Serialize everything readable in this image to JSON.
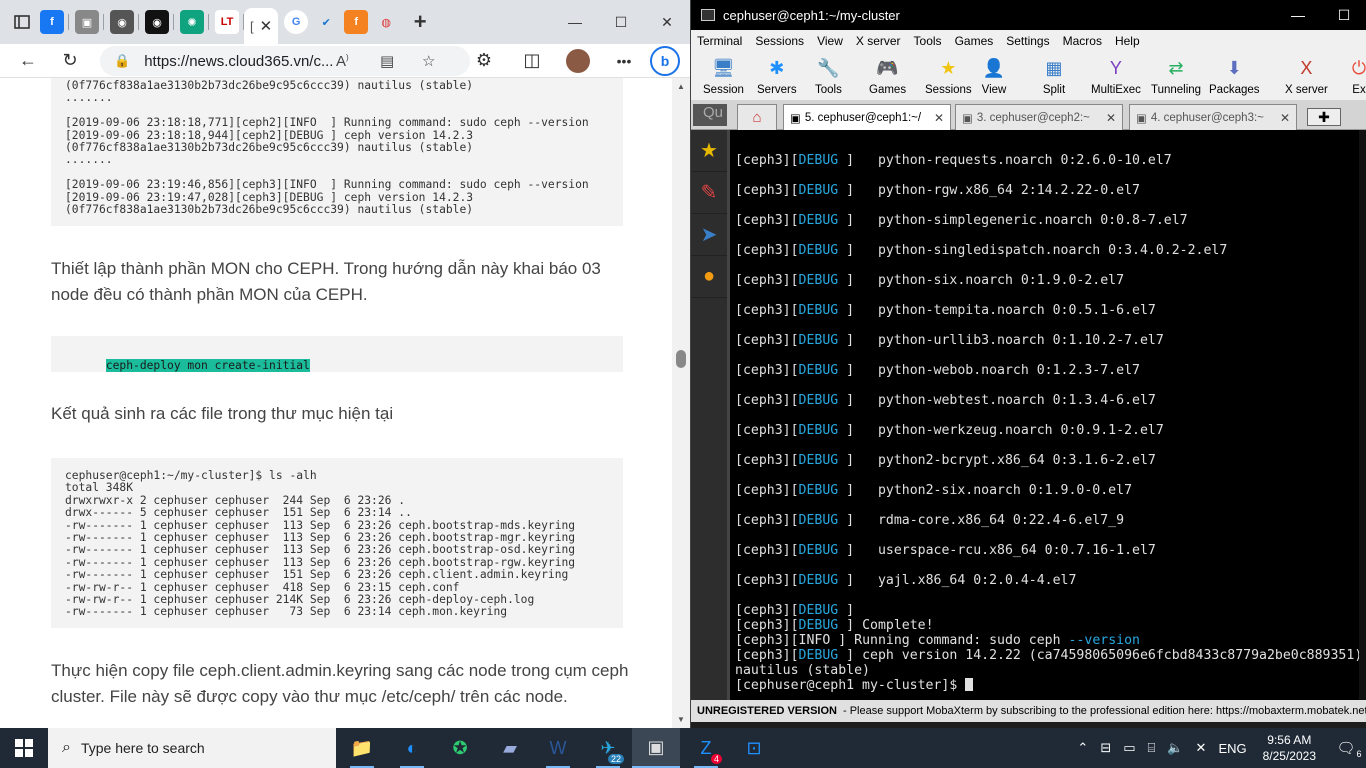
{
  "browser": {
    "tabs": [
      {
        "name": "tab-facebook",
        "glyph": "f",
        "bg": "#1877f2",
        "fg": "#fff"
      },
      {
        "name": "tab-box",
        "glyph": "▣",
        "bg": "#888",
        "fg": "#fff"
      },
      {
        "name": "tab-github-1",
        "glyph": "◉",
        "bg": "#555",
        "fg": "#fff"
      },
      {
        "name": "tab-github-2",
        "glyph": "◉",
        "bg": "#111",
        "fg": "#fff"
      },
      {
        "name": "tab-chatgpt",
        "glyph": "✺",
        "bg": "#10a37f",
        "fg": "#fff"
      },
      {
        "name": "tab-lt",
        "glyph": "LT",
        "bg": "#fff",
        "fg": "#c00"
      },
      {
        "name": "tab-google",
        "glyph": "G",
        "bg": "#fff",
        "fg": "#4285f4"
      },
      {
        "name": "tab-vk",
        "glyph": "✔",
        "bg": "#fff",
        "fg": "#1976d2"
      },
      {
        "name": "tab-f-orange",
        "glyph": "f",
        "bg": "#f58220",
        "fg": "#fff"
      },
      {
        "name": "tab-pinterest",
        "glyph": "◍",
        "bg": "#fff",
        "fg": "#d33"
      }
    ],
    "active_tab_glyph": "[",
    "url": "https://news.cloud365.vn/c...",
    "code_top": "(0f776cf838a1ae3130b2b73dc26be9c95c6ccc39) nautilus (stable)\n.......\n\n[2019-09-06 23:18:18,771][ceph2][INFO  ] Running command: sudo ceph --version\n[2019-09-06 23:18:18,944][ceph2][DEBUG ] ceph version 14.2.3\n(0f776cf838a1ae3130b2b73dc26be9c95c6ccc39) nautilus (stable)\n.......\n\n[2019-09-06 23:19:46,856][ceph3][INFO  ] Running command: sudo ceph --version\n[2019-09-06 23:19:47,028][ceph3][DEBUG ] ceph version 14.2.3\n(0f776cf838a1ae3130b2b73dc26be9c95c6ccc39) nautilus (stable)",
    "para1": "Thiết lập thành phần MON cho CEPH. Trong hướng dẫn này khai báo 03 node đều có thành phần MON của CEPH.",
    "cmd": "ceph-deploy mon create-initial",
    "para2": "Kết quả sinh ra các file trong thư mục hiện tại",
    "code_ls": "cephuser@ceph1:~/my-cluster]$ ls -alh\ntotal 348K\ndrwxrwxr-x 2 cephuser cephuser  244 Sep  6 23:26 .\ndrwx------ 5 cephuser cephuser  151 Sep  6 23:14 ..\n-rw------- 1 cephuser cephuser  113 Sep  6 23:26 ceph.bootstrap-mds.keyring\n-rw------- 1 cephuser cephuser  113 Sep  6 23:26 ceph.bootstrap-mgr.keyring\n-rw------- 1 cephuser cephuser  113 Sep  6 23:26 ceph.bootstrap-osd.keyring\n-rw------- 1 cephuser cephuser  113 Sep  6 23:26 ceph.bootstrap-rgw.keyring\n-rw------- 1 cephuser cephuser  151 Sep  6 23:26 ceph.client.admin.keyring\n-rw-rw-r-- 1 cephuser cephuser  418 Sep  6 23:15 ceph.conf\n-rw-rw-r-- 1 cephuser cephuser 214K Sep  6 23:26 ceph-deploy-ceph.log\n-rw------- 1 cephuser cephuser   73 Sep  6 23:14 ceph.mon.keyring",
    "para3": "Thực hiện copy file ceph.client.admin.keyring sang các node trong cụm ceph cluster. File này sẽ được copy vào thư mục /etc/ceph/ trên các node."
  },
  "moba": {
    "title": "cephuser@ceph1:~/my-cluster",
    "menu": [
      "Terminal",
      "Sessions",
      "View",
      "X server",
      "Tools",
      "Games",
      "Settings",
      "Macros",
      "Help"
    ],
    "toolbar": [
      {
        "label": "Session",
        "icon": "🖥"
      },
      {
        "label": "Servers",
        "icon": "✱"
      },
      {
        "label": "Tools",
        "icon": "🔧"
      },
      {
        "label": "Games",
        "icon": "🎮"
      },
      {
        "label": "Sessions",
        "icon": "★"
      },
      {
        "label": "View",
        "icon": "👤"
      },
      {
        "label": "Split",
        "icon": "▦"
      },
      {
        "label": "MultiExec",
        "icon": "Y"
      },
      {
        "label": "Tunneling",
        "icon": "⇄"
      },
      {
        "label": "Packages",
        "icon": "⬇"
      },
      {
        "label": "X server",
        "icon": "X"
      },
      {
        "label": "Ex",
        "icon": "⏻"
      }
    ],
    "quick_connect": "Qu",
    "session_tabs": [
      "5. cephuser@ceph1:~/",
      "3. cephuser@ceph2:~",
      "4. cephuser@ceph3:~"
    ],
    "packages": [
      "python-requests.noarch 0:2.6.0-10.el7",
      "python-rgw.x86_64 2:14.2.22-0.el7",
      "python-simplegeneric.noarch 0:0.8-7.el7",
      "python-singledispatch.noarch 0:3.4.0.2-2.el7",
      "python-six.noarch 0:1.9.0-2.el7",
      "python-tempita.noarch 0:0.5.1-6.el7",
      "python-urllib3.noarch 0:1.10.2-7.el7",
      "python-webob.noarch 0:1.2.3-7.el7",
      "python-webtest.noarch 0:1.3.4-6.el7",
      "python-werkzeug.noarch 0:0.9.1-2.el7",
      "python2-bcrypt.x86_64 0:3.1.6-2.el7",
      "python2-six.noarch 0:1.9.0-0.el7",
      "rdma-core.x86_64 0:22.4-6.el7_9",
      "userspace-rcu.x86_64 0:0.7.16-1.el7",
      "yajl.x86_64 0:2.0.4-4.el7"
    ],
    "tail": {
      "host": "[ceph3]",
      "debug": "DEBUG",
      "info": "INFO ",
      "complete": "Complete!",
      "running": "Running command: sudo ceph ",
      "version_flag": "--version",
      "version_out": "ceph version 14.2.22 (ca74598065096e6fcbd8433c8779a2be0c889351)",
      "nautilus": "nautilus (stable)",
      "prompt": "[cephuser@ceph1 my-cluster]$ "
    },
    "status_unreg": "UNREGISTERED VERSION",
    "status_msg": " -  Please support MobaXterm by subscribing to the professional edition here:  https://mobaxterm.mobatek.net"
  },
  "taskbar": {
    "search_placeholder": "Type here to search",
    "apps": [
      {
        "name": "file-explorer-icon",
        "icon": "📁"
      },
      {
        "name": "edge-icon",
        "icon": "◐"
      },
      {
        "name": "app-green-icon",
        "icon": "✪"
      },
      {
        "name": "app-book-icon",
        "icon": "▰"
      },
      {
        "name": "word-icon",
        "icon": "W"
      },
      {
        "name": "app-badge-22-icon",
        "icon": "✈",
        "badge": "22"
      },
      {
        "name": "mobaxterm-taskbar-icon",
        "icon": "▣"
      },
      {
        "name": "zalo-icon",
        "icon": "Z",
        "badge": "4"
      },
      {
        "name": "teamviewer-icon",
        "icon": "⊡"
      }
    ],
    "tray": [
      "^",
      "⌨",
      "▭",
      "🔋",
      "🔊",
      "⊘"
    ],
    "lang": "ENG",
    "time": "9:56 AM",
    "date": "8/25/2023",
    "notif_count": "6"
  }
}
